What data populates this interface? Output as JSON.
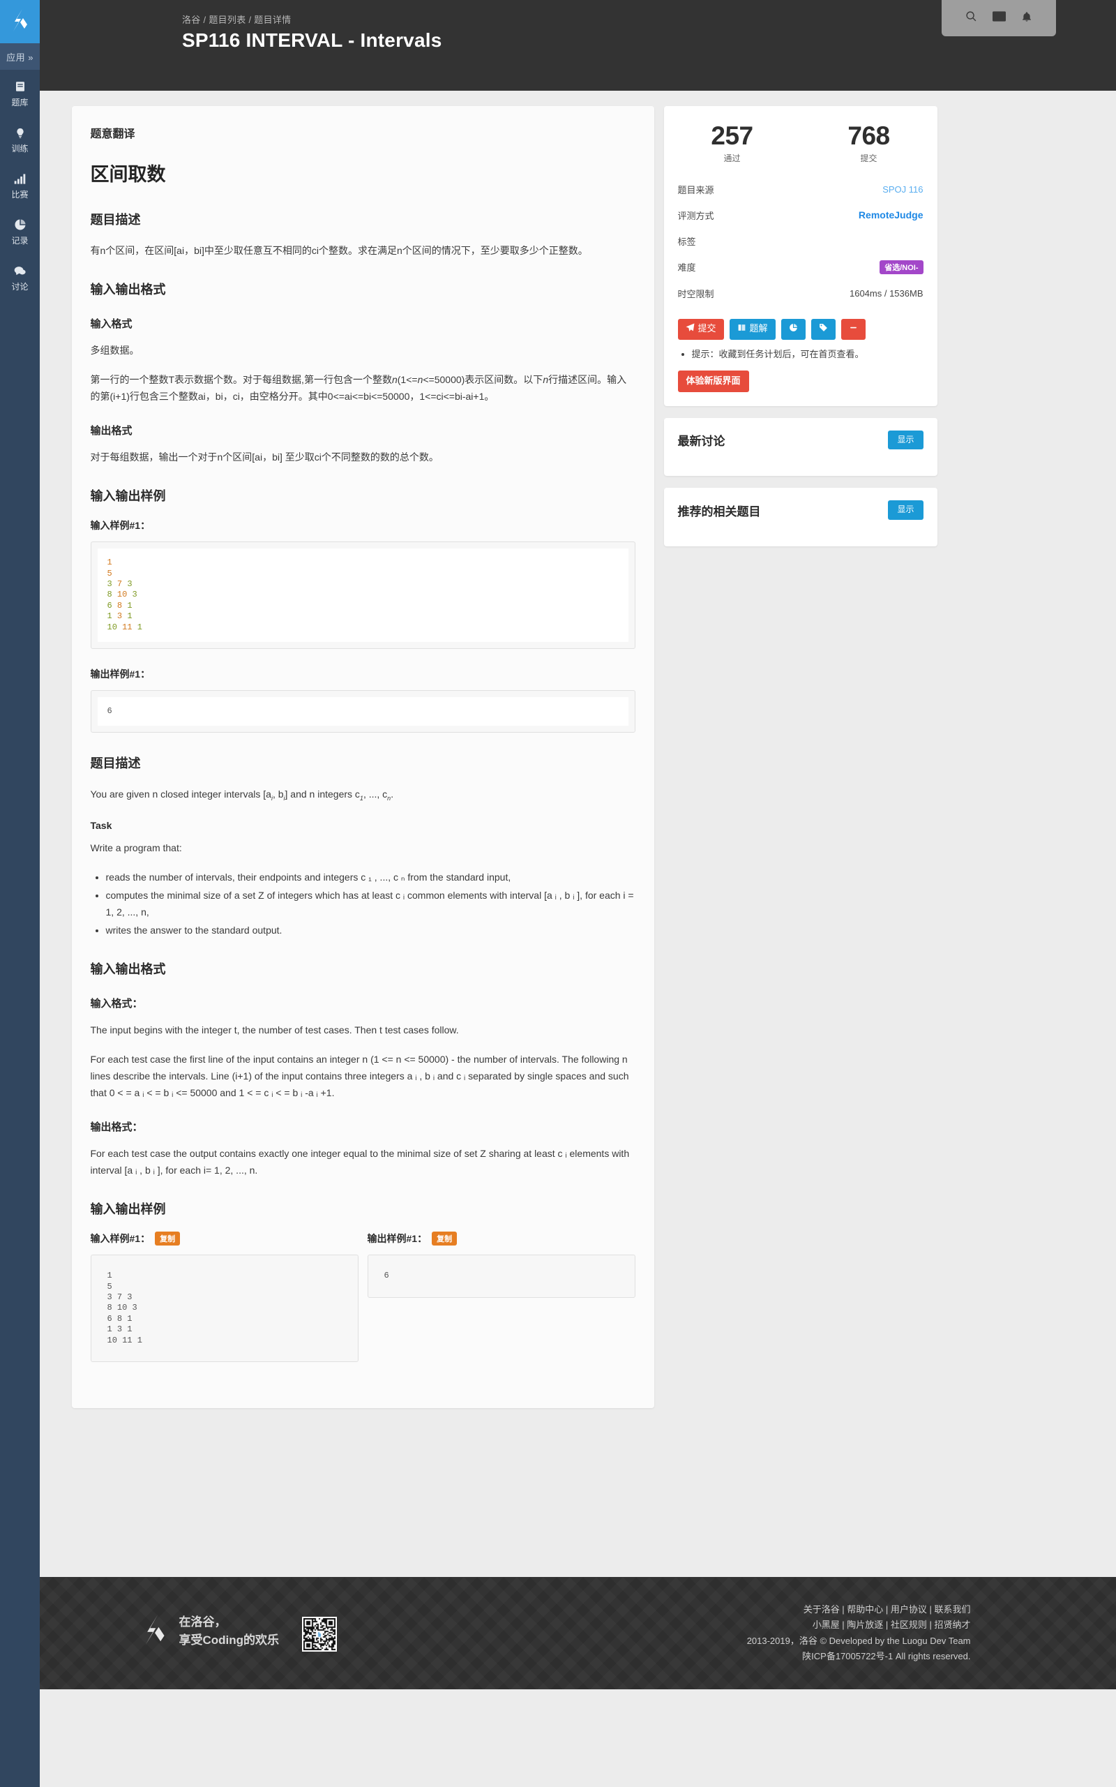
{
  "rail": {
    "logo_icon": "luogu-logo-icon",
    "apps_label": "应用 »",
    "items": [
      {
        "icon": "book-icon",
        "label": "题库"
      },
      {
        "icon": "lightbulb-icon",
        "label": "训练"
      },
      {
        "icon": "bar-chart-icon",
        "label": "比赛"
      },
      {
        "icon": "pie-chart-icon",
        "label": "记录"
      },
      {
        "icon": "comment-icon",
        "label": "讨论"
      }
    ]
  },
  "header": {
    "breadcrumb": "洛谷 / 题目列表 / 题目详情",
    "title": "SP116 INTERVAL - Intervals",
    "tools": [
      {
        "name": "search-icon"
      },
      {
        "name": "mail-icon"
      },
      {
        "name": "bell-icon"
      }
    ]
  },
  "main": {
    "translation_heading": "题意翻译",
    "problem_title": "区间取数",
    "desc_heading_cn": "题目描述",
    "desc_body_cn": "有n个区间，在区间[ai，bi]中至少取任意互不相同的ci个整数。求在满足n个区间的情况下，至少要取多少个正整数。",
    "io_heading_cn": "输入输出格式",
    "in_fmt_heading_cn": "输入格式",
    "in_fmt_p1": "多组数据。",
    "in_fmt_p2_a": "第一行的一个整数T表示数据个数。对于每组数据,第一行包含一个整数",
    "in_fmt_p2_n1": "n",
    "in_fmt_p2_b": "(1<=",
    "in_fmt_p2_n2": "n",
    "in_fmt_p2_c": "<=50000)表示区间数。以下",
    "in_fmt_p2_n3": "n",
    "in_fmt_p2_d": "行描述区间。输入的第(i+1)行包含三个整数ai，bi，ci，由空格分开。其中0<=ai<=bi<=50000，1<=ci<=bi-ai+1。",
    "out_fmt_heading_cn": "输出格式",
    "out_fmt_body_cn": "对于每组数据，输出一个对于n个区间[ai，bi] 至少取ci个不同整数的数的总个数。",
    "sample_heading_cn": "输入输出样例",
    "sample_in_label_cn": "输入样例#1：",
    "sample_out_label_cn": "输出样例#1：",
    "sample_input_lines": [
      "1",
      "5",
      "3 7 3",
      "8 10 3",
      "6 8 1",
      "1 3 1",
      "10 11 1"
    ],
    "sample_output_lines": [
      "6"
    ],
    "desc_heading_en": "题目描述",
    "desc_body_en_1": "You are given n closed integer intervals [a",
    "desc_body_en_2": ", b",
    "desc_body_en_3": "] and n integers c",
    "desc_body_en_4": ", ..., c",
    "desc_body_en_5": ".",
    "task_heading": "Task",
    "task_intro": "Write a program that:",
    "task_bullets": [
      "reads the number of intervals, their endpoints and integers c ₁ , ..., c ₙ from the standard input,",
      "computes the minimal size of a set Z of integers which has at least c ᵢ common elements with interval [a ᵢ , b ᵢ ], for each i = 1, 2, ..., n,",
      "writes the answer to the standard output."
    ],
    "io_heading_en": "输入输出格式",
    "in_fmt_heading_en": "输入格式：",
    "in_fmt_en_p1": "The input begins with the integer t, the number of test cases. Then t test cases follow.",
    "in_fmt_en_p2": "For each test case the first line of the input contains an integer n (1 <= n <= 50000) - the number of intervals. The following n lines describe the intervals. Line (i+1) of the input contains three integers a ᵢ , b ᵢ and c ᵢ separated by single spaces and such that 0 < = a ᵢ < = b ᵢ <= 50000 and 1 < = c ᵢ < = b ᵢ -a ᵢ +1.",
    "out_fmt_heading_en": "输出格式：",
    "out_fmt_en_p1": "For each test case the output contains exactly one integer equal to the minimal size of set Z sharing at least c ᵢ elements with interval [a ᵢ , b ᵢ ], for each i= 1, 2, ..., n.",
    "sample_heading_en": "输入输出样例",
    "copy_label": "复制"
  },
  "sidebar": {
    "stats": [
      {
        "value": "257",
        "label": "通过"
      },
      {
        "value": "768",
        "label": "提交"
      }
    ],
    "meta": [
      {
        "key": "题目来源",
        "value": "SPOJ 116",
        "style": "link"
      },
      {
        "key": "评测方式",
        "value": "RemoteJudge",
        "style": "bold-link"
      },
      {
        "key": "标签",
        "value": "",
        "style": "plain"
      },
      {
        "key": "难度",
        "value": "省选/NOI-",
        "style": "badge"
      },
      {
        "key": "时空限制",
        "value": "1604ms / 1536MB",
        "style": "plain"
      }
    ],
    "buttons": [
      {
        "name": "submit-button",
        "label": "提交",
        "icon": "paper-plane-icon",
        "color": "red"
      },
      {
        "name": "solution-button",
        "label": "题解",
        "icon": "book-open-icon",
        "color": "blue"
      },
      {
        "name": "stats-button",
        "label": "",
        "icon": "pie-chart-icon",
        "color": "blue"
      },
      {
        "name": "tag-button",
        "label": "",
        "icon": "tag-icon",
        "color": "blue"
      },
      {
        "name": "remove-button",
        "label": "",
        "icon": "minus-icon",
        "color": "red"
      }
    ],
    "hint": "提示：收藏到任务计划后，可在首页查看。",
    "new_ui_button": "体验新版界面",
    "panels": [
      {
        "title": "最新讨论",
        "button": "显示"
      },
      {
        "title": "推荐的相关题目",
        "button": "显示"
      }
    ]
  },
  "footer": {
    "logo_icon": "luogu-logo-icon",
    "slogan_line1": "在洛谷，",
    "slogan_line2": "享受Coding的欢乐",
    "qr_name": "qr-code-image",
    "links_row1": "关于洛谷 | 帮助中心 | 用户协议 | 联系我们",
    "links_row2": "小黑屋 | 陶片放逐 | 社区规则 | 招贤纳才",
    "copyright": "2013-2019，洛谷 © Developed by the Luogu Dev Team",
    "icp": "陕ICP备17005722号-1 All rights reserved."
  },
  "colors": {
    "accent_blue": "#1b9ad6",
    "accent_red": "#e74c3c",
    "badge_purple": "#a347c9",
    "copy_orange": "#e67e22",
    "rail_bg": "#31465f",
    "header_bg": "#333333"
  }
}
